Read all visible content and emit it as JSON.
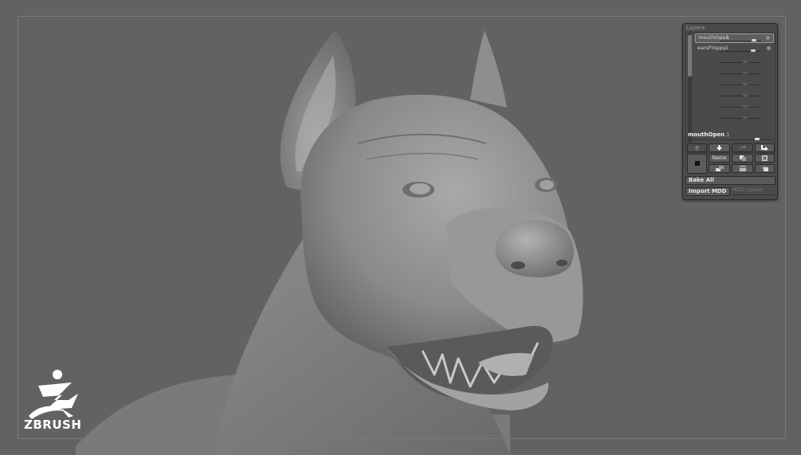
{
  "panel": {
    "title": "Layers",
    "layers": [
      {
        "name": "mouthOpen",
        "value": "1",
        "selected": true
      },
      {
        "name": "earsFloppy",
        "value": "1",
        "selected": false
      },
      {
        "name": "",
        "value": "",
        "selected": false
      },
      {
        "name": "",
        "value": "",
        "selected": false
      },
      {
        "name": "",
        "value": "",
        "selected": false
      },
      {
        "name": "",
        "value": "",
        "selected": false
      },
      {
        "name": "",
        "value": "",
        "selected": false
      },
      {
        "name": "",
        "value": "",
        "selected": false
      }
    ],
    "active_layer": {
      "name": "mouthOpen",
      "value": "1"
    },
    "name_button": "Name",
    "bake_all": "Bake All",
    "import_mdd": "Import MDD",
    "mdd_speed": "MDD Speed"
  },
  "logo": {
    "text": "ZBRUSH",
    "brand_color": "#ffffff"
  },
  "icons": {
    "up": "arrow-up-icon",
    "down": "arrow-down-icon",
    "redo": "redo-icon",
    "export": "export-icon",
    "record": "record-icon",
    "duplicate": "duplicate-icon",
    "delete": "delete-icon",
    "merge_down": "merge-down-icon",
    "split": "split-icon",
    "copy": "copy-icon"
  }
}
